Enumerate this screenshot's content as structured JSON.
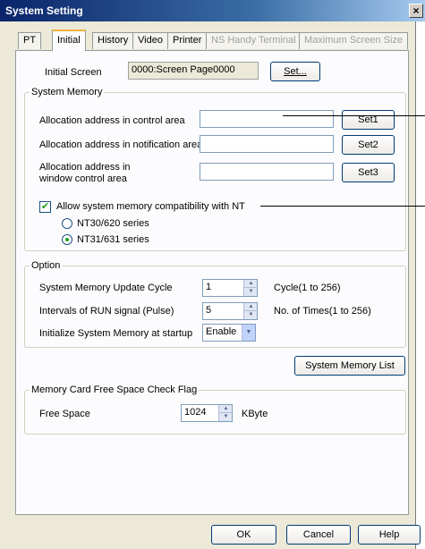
{
  "window": {
    "title": "System Setting",
    "close": "×"
  },
  "tabs": [
    {
      "label": "PT",
      "state": "normal"
    },
    {
      "label": "Initial",
      "state": "active"
    },
    {
      "label": "History",
      "state": "normal"
    },
    {
      "label": "Video",
      "state": "normal"
    },
    {
      "label": "Printer",
      "state": "normal"
    },
    {
      "label": "NS Handy Terminal",
      "state": "disabled"
    },
    {
      "label": "Maximum Screen Size",
      "state": "disabled"
    }
  ],
  "initial_screen": {
    "label": "Initial Screen",
    "value": "0000:Screen Page0000",
    "set_label": "Set..."
  },
  "system_memory": {
    "group_label": "System Memory",
    "control_area": {
      "label": "Allocation address in control area",
      "value": "",
      "button": "Set1"
    },
    "notification_area": {
      "label": "Allocation address in notification area",
      "value": "",
      "button": "Set2"
    },
    "window_control_area": {
      "label_line1": "Allocation address in",
      "label_line2": "window control area",
      "value": "",
      "button": "Set3"
    },
    "compat_checkbox": {
      "label": "Allow system memory compatibility with NT",
      "checked": true
    },
    "radio_nt30": {
      "label": "NT30/620 series",
      "selected": false
    },
    "radio_nt31": {
      "label": "NT31/631 series",
      "selected": true
    }
  },
  "option": {
    "group_label": "Option",
    "update_cycle": {
      "label": "System Memory Update Cycle",
      "value": "1",
      "hint": "Cycle(1 to 256)"
    },
    "run_signal": {
      "label": "Intervals of RUN signal (Pulse)",
      "value": "5",
      "hint": "No. of Times(1 to 256)"
    },
    "init_memory": {
      "label": "Initialize System Memory at startup",
      "value": "Enable"
    }
  },
  "system_memory_list_button": "System Memory List",
  "memory_card": {
    "group_label": "Memory Card Free Space Check Flag",
    "free_space": {
      "label": "Free Space",
      "value": "1024",
      "unit": "KByte"
    }
  },
  "footer": {
    "ok": "OK",
    "cancel": "Cancel",
    "help": "Help"
  }
}
